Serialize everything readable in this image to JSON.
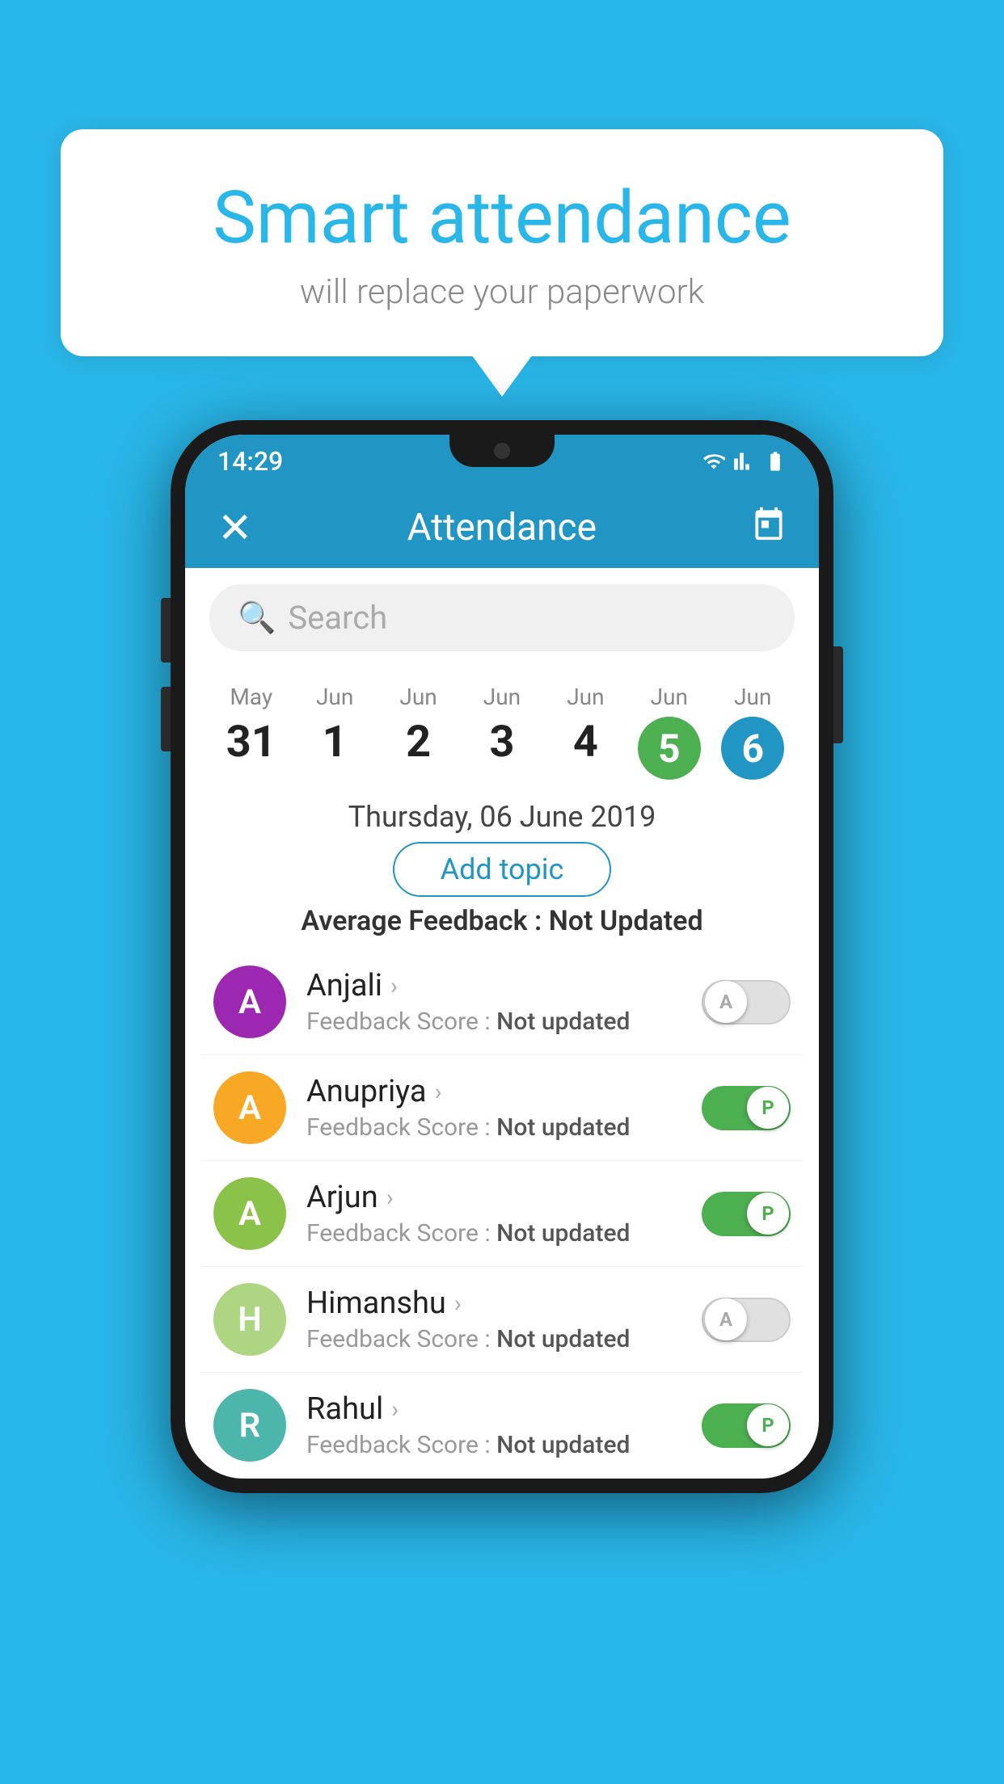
{
  "background_color": "#29b6e8",
  "speech_bubble": {
    "title": "Smart attendance",
    "subtitle": "will replace your paperwork"
  },
  "phone": {
    "status_bar": {
      "time": "14:29"
    },
    "header": {
      "close_label": "✕",
      "title": "Attendance",
      "calendar_icon": "calendar-icon"
    },
    "search": {
      "placeholder": "Search"
    },
    "dates": [
      {
        "month": "May",
        "day": "31",
        "selected": false
      },
      {
        "month": "Jun",
        "day": "1",
        "selected": false
      },
      {
        "month": "Jun",
        "day": "2",
        "selected": false
      },
      {
        "month": "Jun",
        "day": "3",
        "selected": false
      },
      {
        "month": "Jun",
        "day": "4",
        "selected": false
      },
      {
        "month": "Jun",
        "day": "5",
        "selected": "green"
      },
      {
        "month": "Jun",
        "day": "6",
        "selected": "blue"
      }
    ],
    "selected_date_label": "Thursday, 06 June 2019",
    "add_topic_button": "Add topic",
    "avg_feedback_label": "Average Feedback : ",
    "avg_feedback_value": "Not Updated",
    "students": [
      {
        "name": "Anjali",
        "avatar_letter": "A",
        "avatar_color": "#9c27b0",
        "feedback": "Feedback Score : ",
        "feedback_value": "Not updated",
        "toggle": "off",
        "toggle_label": "A"
      },
      {
        "name": "Anupriya",
        "avatar_letter": "A",
        "avatar_color": "#f9a825",
        "feedback": "Feedback Score : ",
        "feedback_value": "Not updated",
        "toggle": "on",
        "toggle_label": "P"
      },
      {
        "name": "Arjun",
        "avatar_letter": "A",
        "avatar_color": "#8bc34a",
        "feedback": "Feedback Score : ",
        "feedback_value": "Not updated",
        "toggle": "on",
        "toggle_label": "P"
      },
      {
        "name": "Himanshu",
        "avatar_letter": "H",
        "avatar_color": "#aed581",
        "feedback": "Feedback Score : ",
        "feedback_value": "Not updated",
        "toggle": "off",
        "toggle_label": "A"
      },
      {
        "name": "Rahul",
        "avatar_letter": "R",
        "avatar_color": "#4db6ac",
        "feedback": "Feedback Score : ",
        "feedback_value": "Not updated",
        "toggle": "on",
        "toggle_label": "P"
      }
    ]
  }
}
